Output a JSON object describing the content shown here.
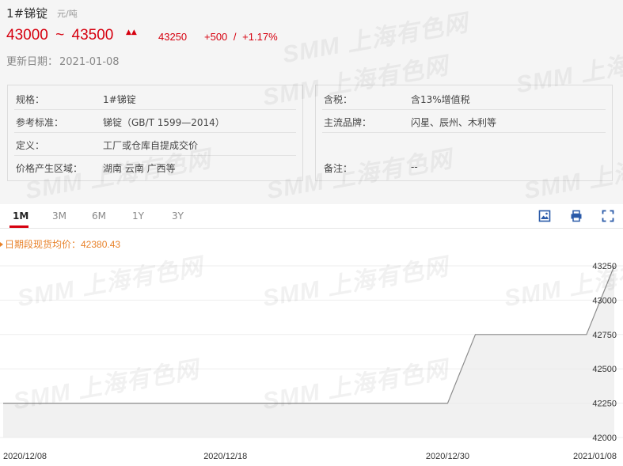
{
  "product": {
    "name": "1#锑锭",
    "unit": "元/吨",
    "price_low": "43000",
    "price_sep": "~",
    "price_high": "43500",
    "avg_price": "43250",
    "change_abs": "+500",
    "change_sep": "/",
    "change_pct": "+1.17%",
    "update_label": "更新日期：",
    "update_date": "2021-01-08",
    "accent_color": "#d6000f"
  },
  "info_left": [
    {
      "label": "规格：",
      "value": "1#锑锭"
    },
    {
      "label": "参考标准：",
      "value": "锑锭（GB/T 1599—2014）"
    },
    {
      "label": "定义：",
      "value": "工厂或仓库自提成交价"
    },
    {
      "label": "价格产生区域：",
      "value": "湖南 云南 广西等"
    }
  ],
  "info_right": [
    {
      "label": "含税：",
      "value": "含13%增值税"
    },
    {
      "label": "主流品牌：",
      "value": "闪星、辰州、木利等"
    },
    {
      "label": "备注：",
      "value": "--"
    }
  ],
  "tabs": [
    {
      "label": "1M",
      "active": true
    },
    {
      "label": "3M",
      "active": false
    },
    {
      "label": "6M",
      "active": false
    },
    {
      "label": "1Y",
      "active": false
    },
    {
      "label": "3Y",
      "active": false
    }
  ],
  "toolbar": {
    "icons": [
      "image-download-icon",
      "print-icon",
      "fullscreen-icon"
    ]
  },
  "legend": {
    "text": "日期段现货均价：42380.43"
  },
  "watermark": "SMM 上海有色网",
  "chart_data": {
    "type": "area",
    "x": [
      "2020/12/08",
      "2020/12/09",
      "2020/12/10",
      "2020/12/11",
      "2020/12/14",
      "2020/12/15",
      "2020/12/16",
      "2020/12/17",
      "2020/12/18",
      "2020/12/21",
      "2020/12/22",
      "2020/12/23",
      "2020/12/24",
      "2020/12/25",
      "2020/12/28",
      "2020/12/29",
      "2020/12/30",
      "2020/12/31",
      "2021/01/04",
      "2021/01/05",
      "2021/01/06",
      "2021/01/07",
      "2021/01/08"
    ],
    "values": [
      42250,
      42250,
      42250,
      42250,
      42250,
      42250,
      42250,
      42250,
      42250,
      42250,
      42250,
      42250,
      42250,
      42250,
      42250,
      42250,
      42250,
      42750,
      42750,
      42750,
      42750,
      42750,
      43250
    ],
    "x_tick_labels": [
      "2020/12/08",
      "2020/12/18",
      "2020/12/30",
      "2021/01/08"
    ],
    "y_ticks": [
      42000,
      42250,
      42500,
      42750,
      43000,
      43250
    ],
    "ylim": [
      42000,
      43250
    ],
    "grid": true,
    "line_color": "#8c8c8c",
    "fill_color": "#e9e9e9"
  }
}
